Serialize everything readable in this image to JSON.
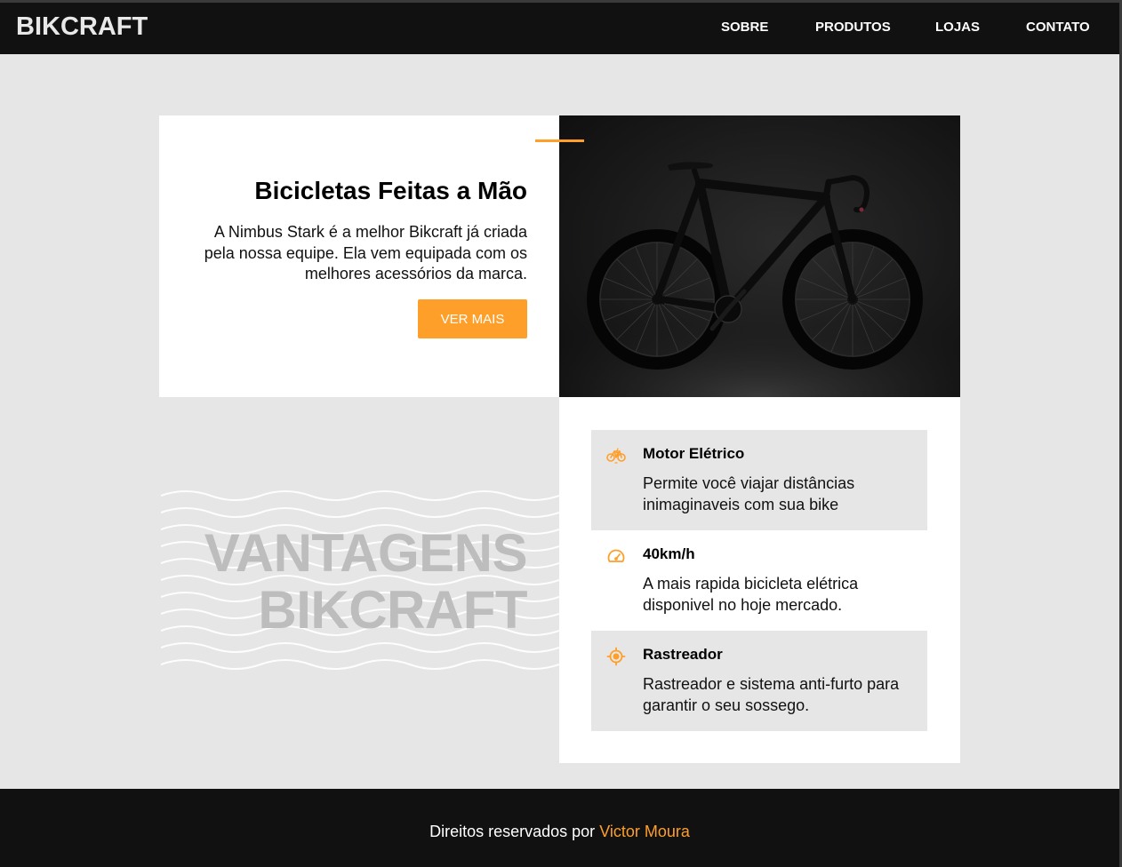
{
  "header": {
    "logo": "BIKCRAFT",
    "nav": [
      {
        "label": "SOBRE"
      },
      {
        "label": "PRODUTOS"
      },
      {
        "label": "LOJAS"
      },
      {
        "label": "CONTATO"
      }
    ]
  },
  "intro": {
    "title": "Bicicletas Feitas a Mão",
    "description": "A Nimbus Stark é a melhor Bikcraft já criada pela nossa equipe. Ela vem equipada com os melhores acessórios da marca.",
    "button_label": "VER MAIS",
    "image_icon": "road-bicycle-photo"
  },
  "vantagens": {
    "title_line1": "VANTAGENS",
    "title_line2": "BIKCRAFT",
    "items": [
      {
        "icon": "electric-bike-icon",
        "title": "Motor Elétrico",
        "description": "Permite você viajar distâncias inimaginaveis com sua bike"
      },
      {
        "icon": "speedometer-icon",
        "title": "40km/h",
        "description": "A mais rapida bicicleta elétrica disponivel no hoje mercado."
      },
      {
        "icon": "target-icon",
        "title": "Rastreador",
        "description": "Rastreador e sistema anti-furto para garantir o seu sossego."
      }
    ]
  },
  "footer": {
    "text": "Direitos reservados por",
    "author": "Victor Moura"
  },
  "colors": {
    "accent": "#fe9f2a",
    "dark": "#111111",
    "background": "#e6e6e6",
    "title_gray": "#bdbdbd"
  }
}
